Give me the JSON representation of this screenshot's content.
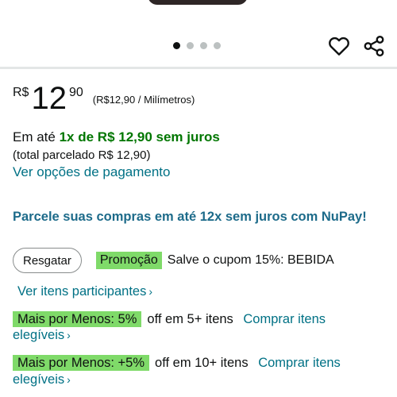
{
  "gallery": {
    "dots": [
      true,
      false,
      false,
      false
    ]
  },
  "actions": {
    "favorite_icon": "heart-outline-icon",
    "share_icon": "share-icon"
  },
  "price": {
    "symbol": "R$",
    "whole": "12",
    "fraction": "90",
    "unit_price": "(R$12,90 / Milímetros)"
  },
  "installments": {
    "prefix": "Em até",
    "highlight": "1x de R$ 12,90 sem juros",
    "total": "(total parcelado R$ 12,90)",
    "payment_options_link": "Ver opções de pagamento"
  },
  "nupay": {
    "text": "Parcele suas compras em até 12x sem juros com NuPay!"
  },
  "coupon": {
    "button_label": "Resgatar",
    "badge": "Promoção",
    "text": "Salve o cupom 15%: BEBIDA",
    "participants_link": "Ver itens participantes",
    "chevron": "›"
  },
  "mais_por_menos": [
    {
      "badge": "Mais por Menos: 5%",
      "off_text": "off em 5+ itens",
      "link_part1": "Comprar itens",
      "link_part2": "elegíveis",
      "chevron": "›"
    },
    {
      "badge": "Mais por Menos: +5%",
      "off_text": "off em 10+ itens",
      "link_part1": "Comprar itens",
      "link_part2": "elegíveis",
      "chevron": "›"
    }
  ],
  "colors": {
    "link": "#007185",
    "green_text": "#007600",
    "badge_green": "#7fda69",
    "nupay_blue": "#1d6b8a"
  }
}
